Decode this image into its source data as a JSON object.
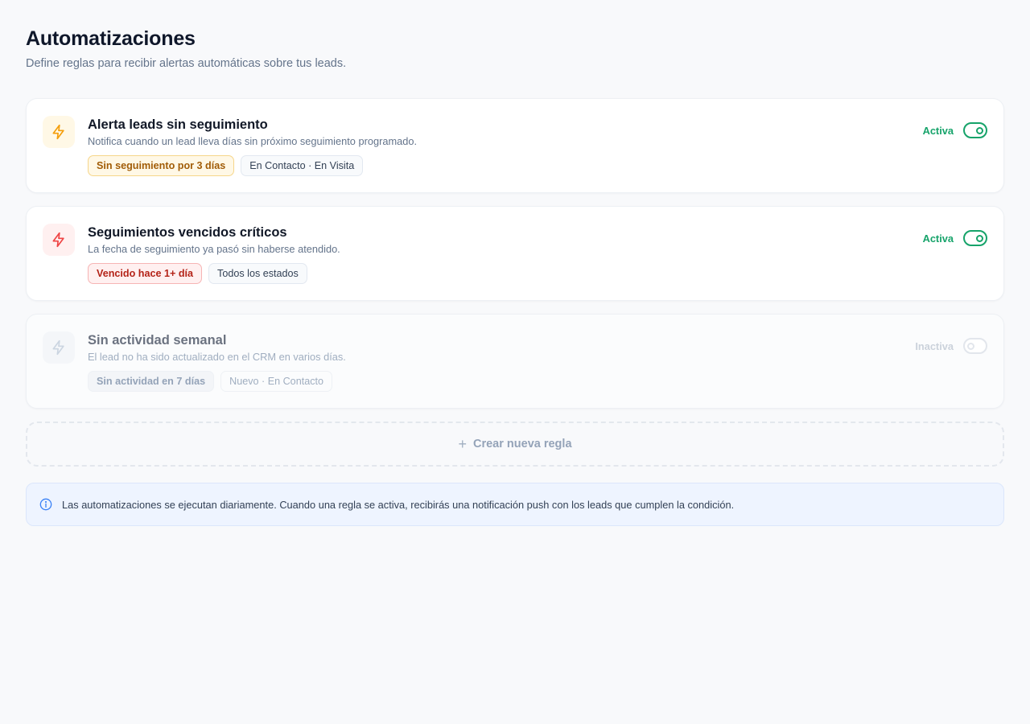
{
  "header": {
    "title": "Automatizaciones",
    "subtitle": "Define reglas para recibir alertas automáticas sobre tus leads."
  },
  "rules": [
    {
      "title": "Alerta leads sin seguimiento",
      "description": "Notifica cuando un lead lleva días sin próximo seguimiento programado.",
      "condition": "Sin seguimiento por 3 días",
      "scope": "En Contacto · En Visita",
      "status": "Activa",
      "enabled": true,
      "icon": "bolt-icon",
      "icon_color": "#f59e0b",
      "icon_bg": "#fff8e6"
    },
    {
      "title": "Seguimientos vencidos críticos",
      "description": "La fecha de seguimiento ya pasó sin haberse atendido.",
      "condition": "Vencido hace 1+ día",
      "scope": "Todos los estados",
      "status": "Activa",
      "enabled": true,
      "icon": "bolt-icon",
      "icon_color": "#ef4444",
      "icon_bg": "#fff0f0"
    },
    {
      "title": "Sin actividad semanal",
      "description": "El lead no ha sido actualizado en el CRM en varios días.",
      "condition": "Sin actividad en 7 días",
      "scope": "Nuevo · En Contacto",
      "status": "Inactiva",
      "enabled": false,
      "icon": "bolt-icon",
      "icon_color": "#cbd5e1",
      "icon_bg": "#f4f6f9"
    }
  ],
  "create_rule": {
    "label": "Crear nueva regla",
    "icon": "plus-icon"
  },
  "info": {
    "icon": "info-icon",
    "text": "Las automatizaciones se ejecutan diariamente. Cuando una regla se activa, recibirás una notificación push con los leads que cumplen la condición."
  },
  "colors": {
    "active_green": "#16a36a",
    "info_blue": "#3b82f6"
  }
}
